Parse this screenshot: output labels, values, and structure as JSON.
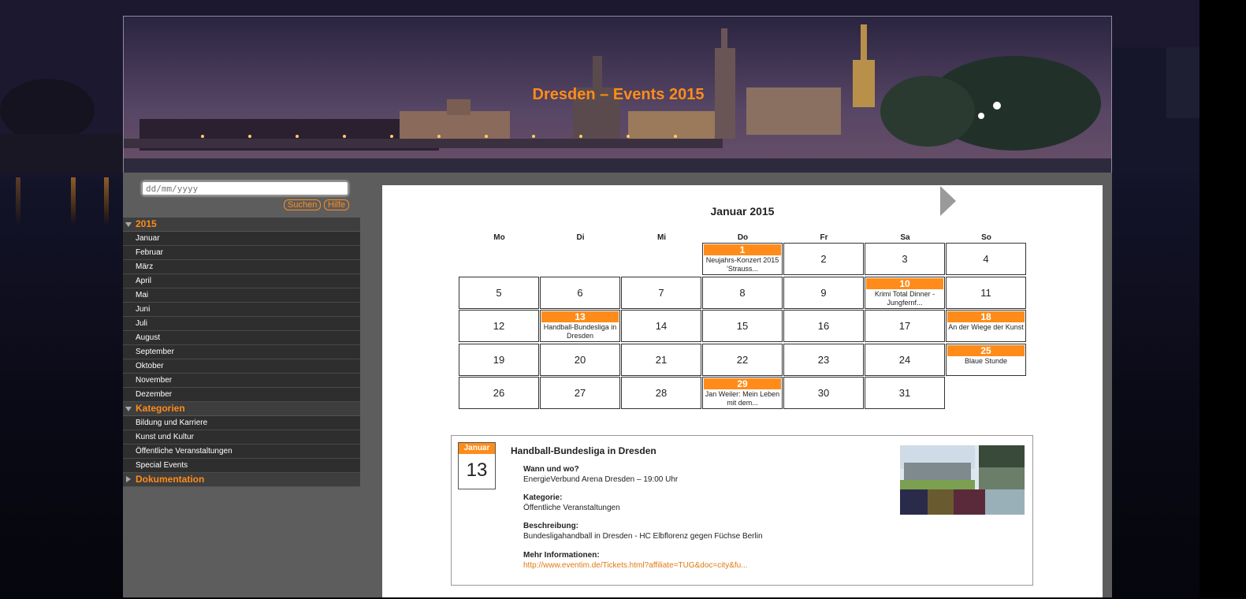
{
  "site": {
    "title": "Dresden – Events 2015"
  },
  "search": {
    "placeholder": "dd/mm/yyyy",
    "search_label": "Suchen",
    "help_label": "Hilfe"
  },
  "menu": {
    "year_label": "2015",
    "months": [
      "Januar",
      "Februar",
      "März",
      "April",
      "Mai",
      "Juni",
      "Juli",
      "August",
      "September",
      "Oktober",
      "November",
      "Dezember"
    ],
    "categories_label": "Kategorien",
    "categories": [
      "Bildung und Karriere",
      "Kunst und Kultur",
      "Öffentliche Veranstaltungen",
      "Special Events"
    ],
    "docs_label": "Dokumentation"
  },
  "calendar": {
    "title": "Januar 2015",
    "weekdays": [
      "Mo",
      "Di",
      "Mi",
      "Do",
      "Fr",
      "Sa",
      "So"
    ],
    "first_weekday_index": 3,
    "days_in_month": 31,
    "events": {
      "1": "Neujahrs-Konzert 2015 'Strauss...",
      "10": "Krimi Total Dinner - Jungfernf...",
      "13": "Handball-Bundesliga in Dresden",
      "18": "An der Wiege der Kunst",
      "25": "Blaue Stunde",
      "29": "Jan Weiler: Mein Leben mit dem..."
    }
  },
  "detail": {
    "month": "Januar",
    "day": "13",
    "title": "Handball-Bundesliga in Dresden",
    "where_label": "Wann und wo?",
    "where_value": "EnergieVerbund Arena Dresden – 19:00 Uhr",
    "category_label": "Kategorie:",
    "category_value": "Öffentliche Veranstaltungen",
    "description_label": "Beschreibung:",
    "description_value": "Bundesligahandball in Dresden - HC Elbflorenz gegen Füchse Berlin",
    "more_label": "Mehr Informationen:",
    "more_link": "http://www.eventim.de/Tickets.html?affiliate=TUG&doc=city&fu..."
  },
  "colors": {
    "accent": "#ff8c1a",
    "sidebar_dark": "#2e2e2e",
    "content_bg": "#5d5d5d"
  }
}
